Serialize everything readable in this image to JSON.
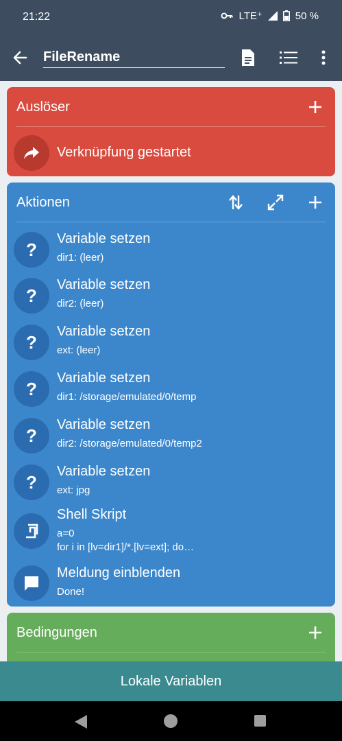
{
  "status_bar": {
    "time": "21:22",
    "network": "LTE⁺",
    "battery": "50 %"
  },
  "app_bar": {
    "title": "FileRename"
  },
  "trigger": {
    "header": "Auslöser",
    "items": [
      {
        "title": "Verknüpfung gestartet"
      }
    ]
  },
  "actions": {
    "header": "Aktionen",
    "items": [
      {
        "title": "Variable setzen",
        "subtitle": "dir1: (leer)",
        "icon": "?"
      },
      {
        "title": "Variable setzen",
        "subtitle": "dir2: (leer)",
        "icon": "?"
      },
      {
        "title": "Variable setzen",
        "subtitle": "ext: (leer)",
        "icon": "?"
      },
      {
        "title": "Variable setzen",
        "subtitle": "dir1: /storage/emulated/0/temp",
        "icon": "?"
      },
      {
        "title": "Variable setzen",
        "subtitle": "dir2: /storage/emulated/0/temp2",
        "icon": "?"
      },
      {
        "title": "Variable setzen",
        "subtitle": "ext: jpg",
        "icon": "?"
      },
      {
        "title": "Shell Skript",
        "subtitle": "a=0",
        "subtitle2": "for i in [lv=dir1]/*.[lv=ext]; do…"
      },
      {
        "title": "Meldung einblenden",
        "subtitle": "Done!"
      }
    ]
  },
  "conditions": {
    "header": "Bedingungen"
  },
  "bottom_button": {
    "label": "Lokale Variablen"
  },
  "colors": {
    "app_bar": "#3d4c5e",
    "trigger": "#d94b3e",
    "actions": "#3c87cc",
    "conditions": "#66ad5b",
    "bottom_button": "#3a8a8f"
  }
}
